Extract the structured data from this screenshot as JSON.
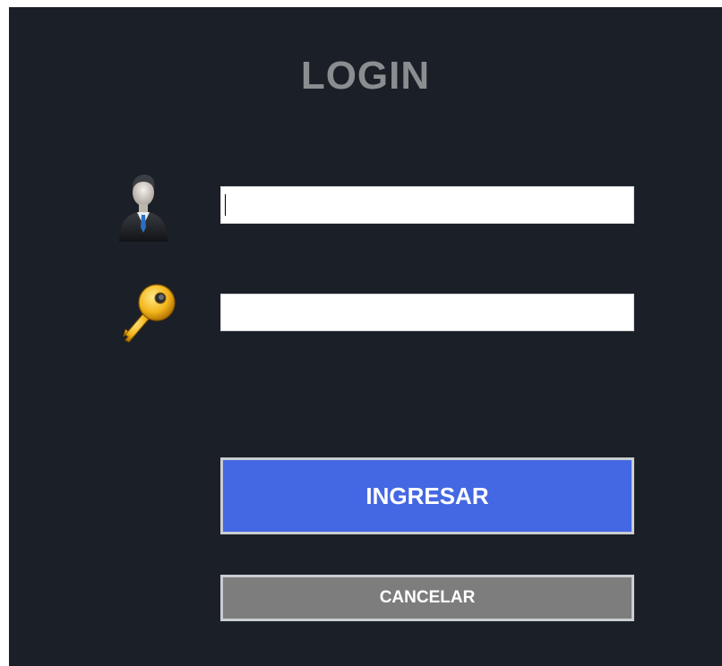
{
  "login": {
    "title": "LOGIN",
    "username": {
      "value": "",
      "placeholder": ""
    },
    "password": {
      "value": "",
      "placeholder": ""
    },
    "submit_label": "INGRESAR",
    "cancel_label": "CANCELAR"
  },
  "icons": {
    "user": "user-businessman-icon",
    "password": "key-icon"
  },
  "colors": {
    "panel_bg": "#1b1f27",
    "title": "#8b8e91",
    "primary_button": "#4468e3",
    "secondary_button": "#7d7d7d",
    "button_border": "#c9ccd0"
  }
}
